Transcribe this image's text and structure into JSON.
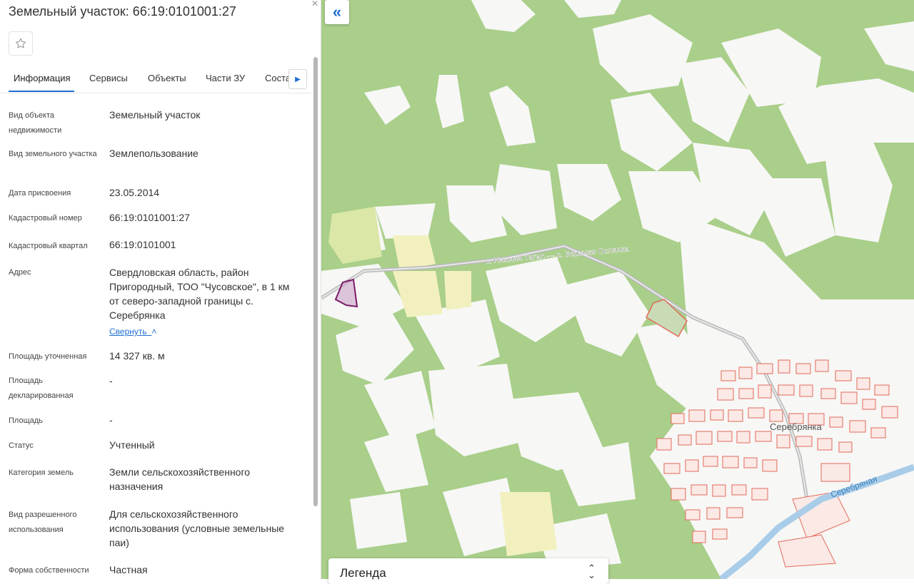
{
  "header": {
    "title": "Земельный участок: 66:19:0101001:27"
  },
  "tabs": [
    "Информация",
    "Сервисы",
    "Объекты",
    "Части ЗУ",
    "Соста"
  ],
  "info": [
    {
      "label": "Вид объекта недвижимости",
      "value": "Земельный участок"
    },
    {
      "label": "Вид земельного участка",
      "value": "Землепользование"
    },
    {
      "label": "Дата присвоения",
      "value": "23.05.2014"
    },
    {
      "label": "Кадастровый номер",
      "value": "66:19:0101001:27"
    },
    {
      "label": "Кадастровый квартал",
      "value": "66:19:0101001"
    },
    {
      "label": "Адрес",
      "value": "Свердловская область, район Пригородный, ТОО \"Чусовское\", в 1 км от северо-западной границы с. Серебрянка"
    },
    {
      "label": "Площадь уточненная",
      "value": "14 327 кв. м"
    },
    {
      "label": "Площадь декларированная",
      "value": "-"
    },
    {
      "label": "Площадь",
      "value": "-"
    },
    {
      "label": "Статус",
      "value": "Учтенный"
    },
    {
      "label": "Категория земель",
      "value": "Земли сельскохозяйственного назначения"
    },
    {
      "label": "Вид разрешенного использования",
      "value": "Для сельскохозяйственного использования (условные земельные паи)"
    },
    {
      "label": "Форма собственности",
      "value": "Частная"
    }
  ],
  "collapse_label": "Свернуть",
  "map": {
    "road_label": "с. Нижний Тагил — с. Верхняя Ослянка",
    "village_label": "Серебрянка",
    "river_label": "Серебряная"
  },
  "legend": {
    "label": "Легенда"
  },
  "colors": {
    "accent": "#1f6fd1",
    "forest": "#a9cf8a",
    "parcel": "#e26a5a"
  }
}
